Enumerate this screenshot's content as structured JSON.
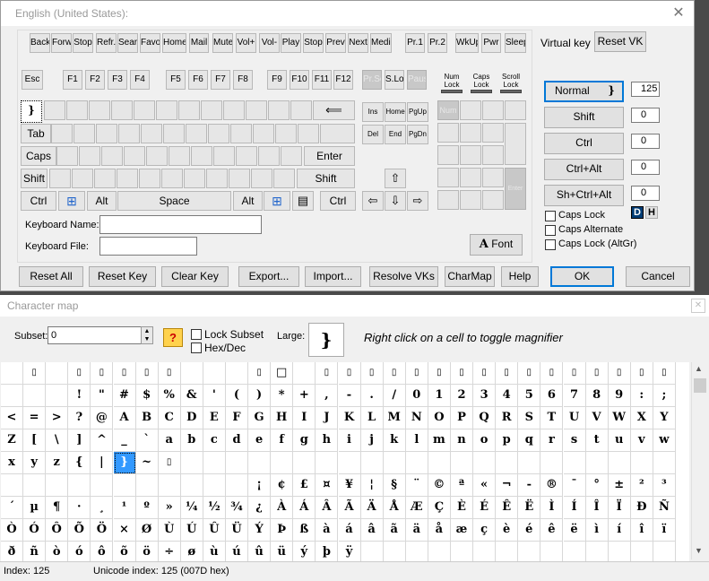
{
  "vk_window": {
    "title": "English (United States):",
    "media_keys": [
      "Back",
      "Forw.",
      "Stop",
      "Refr.",
      "Searc",
      "Favor",
      "Home",
      "Mail",
      "Mute",
      "Vol+",
      "Vol-",
      "Play",
      "Stop",
      "Prev",
      "Next",
      "Media",
      "Pr.1",
      "Pr.2",
      "WkUp",
      "Pwr",
      "Sleep"
    ],
    "fn_keys": [
      "Esc",
      "F1",
      "F2",
      "F3",
      "F4",
      "F5",
      "F6",
      "F7",
      "F8",
      "F9",
      "F10",
      "F11",
      "F12",
      "Pr.Sc",
      "S.Lock",
      "Pause"
    ],
    "indicators": [
      "Num Lock",
      "Caps Lock",
      "Scroll Lock"
    ],
    "row1_first": "}",
    "left_keys": {
      "tab": "Tab",
      "caps": "Caps",
      "shift": "Shift",
      "ctrl": "Ctrl",
      "alt": "Alt",
      "space": "Space",
      "backspace": "⟸",
      "enter": "Enter",
      "rshift": "Shift",
      "ralt": "Alt",
      "rctrl": "Ctrl"
    },
    "nav_keys": [
      "Ins",
      "Home",
      "PgUp",
      "Del",
      "End",
      "PgDn"
    ],
    "numpad": {
      "num": "Num",
      "enter": "Enter"
    },
    "arrows": {
      "up": "⇧",
      "left": "⇦",
      "down": "⇩",
      "right": "⇨"
    },
    "keyboard_name_label": "Keyboard Name:",
    "keyboard_file_label": "Keyboard File:",
    "keyboard_name_value": "",
    "keyboard_file_value": "",
    "font_button": "Font",
    "font_glyph": "A",
    "virtual_key_label": "Virtual key",
    "reset_vk": "Reset VK",
    "shift_states": [
      {
        "label": "Normal",
        "value": "125",
        "glyph": "}"
      },
      {
        "label": "Shift",
        "value": "0"
      },
      {
        "label": "Ctrl",
        "value": "0"
      },
      {
        "label": "Ctrl+Alt",
        "value": "0"
      },
      {
        "label": "Sh+Ctrl+Alt",
        "value": "0"
      }
    ],
    "dh": {
      "d": "D",
      "h": "H"
    },
    "checks": [
      "Caps Lock",
      "Caps Alternate",
      "Caps Lock (AltGr)"
    ],
    "bottom_buttons": [
      "Reset All",
      "Reset Key",
      "Clear Key",
      "Export...",
      "Import...",
      "Resolve VKs",
      "CharMap",
      "Help",
      "OK",
      "Cancel"
    ]
  },
  "charmap": {
    "title": "Character map",
    "subset_label": "Subset:",
    "subset_value": "0",
    "help_glyph": "?",
    "lock_subset": "Lock Subset",
    "hexdec": "Hex/Dec",
    "large_label": "Large:",
    "large_glyph": "}",
    "hint": "Right click on a cell to toggle magnifier",
    "rows": [
      [
        "",
        "▯",
        "",
        "▯",
        "▯",
        "▯",
        "▯",
        "▯",
        "",
        "",
        "",
        "▯",
        "□",
        "",
        "▯",
        "▯",
        "▯",
        "▯",
        "▯",
        "▯",
        "▯",
        "▯",
        "▯",
        "▯",
        "▯",
        "▯",
        "▯",
        "▯",
        "▯",
        "▯"
      ],
      [
        "",
        "",
        "",
        "!",
        "\"",
        "#",
        "$",
        "%",
        "&",
        "'",
        "(",
        ")",
        "*",
        "+",
        ",",
        "-",
        ".",
        "/",
        "0",
        "1",
        "2",
        "3",
        "4",
        "5",
        "6",
        "7",
        "8",
        "9",
        ":",
        ";"
      ],
      [
        "<",
        "=",
        ">",
        "?",
        "@",
        "A",
        "B",
        "C",
        "D",
        "E",
        "F",
        "G",
        "H",
        "I",
        "J",
        "K",
        "L",
        "M",
        "N",
        "O",
        "P",
        "Q",
        "R",
        "S",
        "T",
        "U",
        "V",
        "W",
        "X",
        "Y"
      ],
      [
        "Z",
        "[",
        "\\",
        "]",
        "^",
        "_",
        "`",
        "a",
        "b",
        "c",
        "d",
        "e",
        "f",
        "g",
        "h",
        "i",
        "j",
        "k",
        "l",
        "m",
        "n",
        "o",
        "p",
        "q",
        "r",
        "s",
        "t",
        "u",
        "v",
        "w"
      ],
      [
        "x",
        "y",
        "z",
        "{",
        "|",
        "}",
        "~",
        "▯",
        "",
        "",
        "",
        "",
        "",
        "",
        "",
        "",
        "",
        "",
        "",
        "",
        "",
        "",
        "",
        "",
        "",
        "",
        "",
        "",
        "",
        ""
      ],
      [
        "",
        "",
        "",
        "",
        "",
        "",
        "",
        "",
        "",
        "",
        "",
        "¡",
        "¢",
        "£",
        "¤",
        "¥",
        "¦",
        "§",
        "¨",
        "©",
        "ª",
        "«",
        "¬",
        "-",
        "®",
        "¯",
        "°",
        "±",
        "²",
        "³"
      ],
      [
        "´",
        "µ",
        "¶",
        "·",
        "¸",
        "¹",
        "º",
        "»",
        "¼",
        "½",
        "¾",
        "¿",
        "À",
        "Á",
        "Â",
        "Ã",
        "Ä",
        "Å",
        "Æ",
        "Ç",
        "È",
        "É",
        "Ê",
        "Ë",
        "Ì",
        "Í",
        "Î",
        "Ï",
        "Ð",
        "Ñ"
      ],
      [
        "Ò",
        "Ó",
        "Ô",
        "Õ",
        "Ö",
        "×",
        "Ø",
        "Ù",
        "Ú",
        "Û",
        "Ü",
        "Ý",
        "Þ",
        "ß",
        "à",
        "á",
        "â",
        "ã",
        "ä",
        "å",
        "æ",
        "ç",
        "è",
        "é",
        "ê",
        "ë",
        "ì",
        "í",
        "î",
        "ï"
      ],
      [
        "ð",
        "ñ",
        "ò",
        "ó",
        "ô",
        "õ",
        "ö",
        "÷",
        "ø",
        "ù",
        "ú",
        "û",
        "ü",
        "ý",
        "þ",
        "ÿ",
        "",
        "",
        "",
        "",
        "",
        "",
        "",
        "",
        "",
        "",
        "",
        "",
        "",
        ""
      ]
    ],
    "selected_row": 4,
    "selected_col": 5,
    "status_index": "Index: 125",
    "status_unicode": "Unicode index: 125 (007D hex)"
  },
  "colors": {
    "accent": "#0078d7",
    "selected_cell": "#3399ff"
  }
}
